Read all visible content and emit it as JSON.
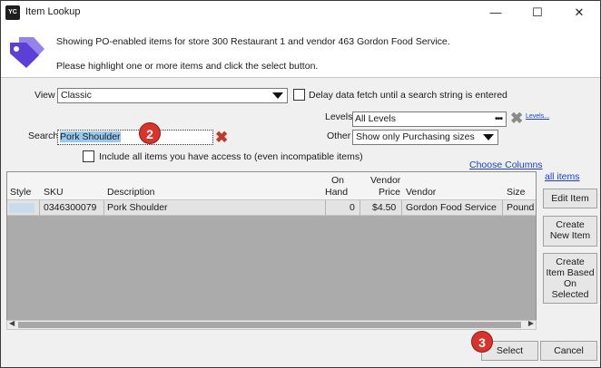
{
  "window": {
    "app_icon_text": "YC",
    "title": "Item Lookup",
    "controls": {
      "minimize": "—",
      "maximize": "☐",
      "close": "✕"
    }
  },
  "header": {
    "line1": "Showing PO-enabled items for store 300 Restaurant 1 and vendor 463 Gordon Food Service.",
    "line2": "Please highlight one or more items and click the select button.",
    "icon": "price-tag-icon",
    "icon_color": "#5b3fd6"
  },
  "filters": {
    "view_label": "View",
    "view_value": "Classic",
    "delay_label": "Delay data fetch until a search string is entered",
    "delay_checked": false,
    "levels_label": "Levels",
    "levels_value": "All Levels",
    "levels_dots": "•••",
    "levels_link": "Levels...",
    "other_label": "Other",
    "other_value": "Show only Purchasing sizes",
    "search_label": "Search",
    "search_value": "Pork Shoulder",
    "include_label": "Include all items you have access to (even incompatible items)",
    "include_checked": false,
    "choose_columns": "Choose Columns",
    "all_items": "all items"
  },
  "callouts": {
    "search": "2",
    "select": "3"
  },
  "grid": {
    "columns": {
      "style": "Style",
      "sku": "SKU",
      "description": "Description",
      "on_hand_1": "On",
      "on_hand_2": "Hand",
      "vendor_price_1": "Vendor",
      "vendor_price_2": "Price",
      "vendor": "Vendor",
      "size": "Size"
    },
    "rows": [
      {
        "sku": "0346300079",
        "description": "Pork Shoulder",
        "on_hand": "0",
        "vendor_price": "$4.50",
        "vendor": "Gordon Food Service",
        "size": "Pound"
      }
    ]
  },
  "side_buttons": {
    "edit_item": "Edit Item",
    "create_new_1": "Create",
    "create_new_2": "New Item",
    "create_based_1": "Create",
    "create_based_2": "Item Based",
    "create_based_3": "On",
    "create_based_4": "Selected"
  },
  "buttons": {
    "select": "Select",
    "cancel": "Cancel"
  },
  "colors": {
    "accent_red": "#d9342b",
    "link_blue": "#1a3fcc",
    "selection": "#99c9ef"
  }
}
